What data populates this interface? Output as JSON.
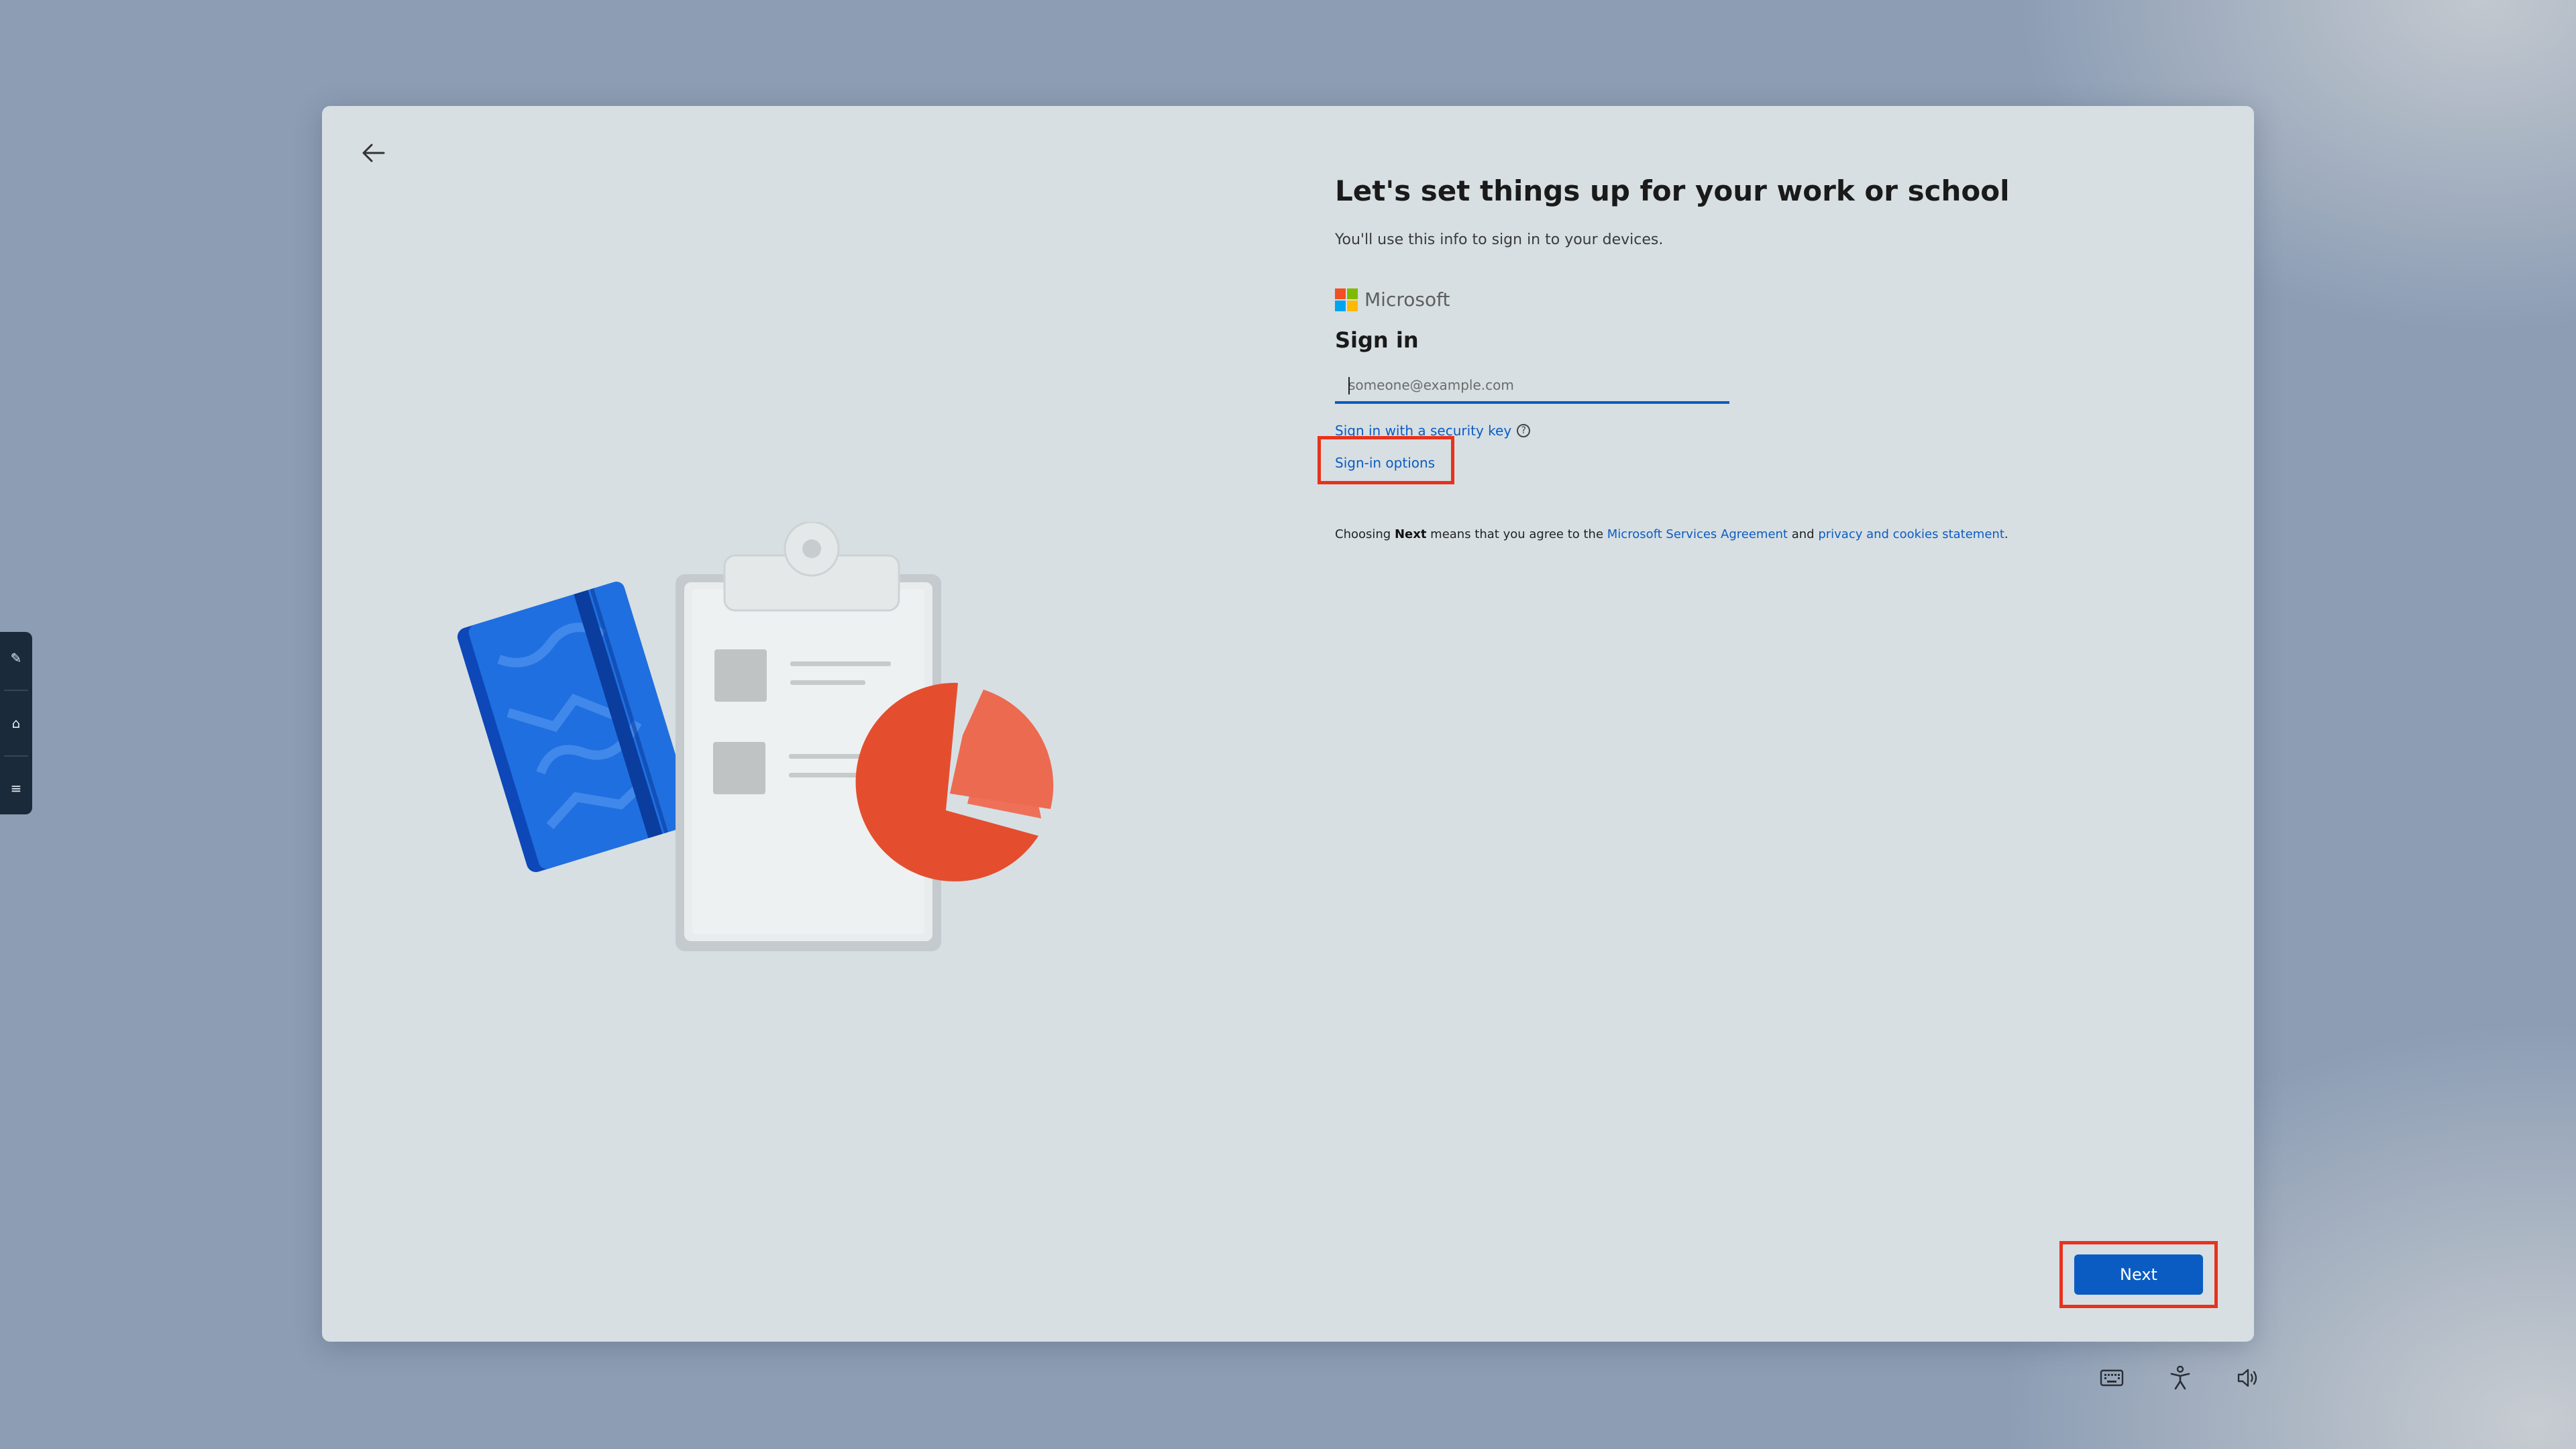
{
  "header": {
    "title": "Let's set things up for your work or school",
    "subtitle": "You'll use this info to sign in to your devices."
  },
  "brand": {
    "name": "Microsoft",
    "colors": [
      "#f25022",
      "#7fba00",
      "#00a4ef",
      "#ffb900"
    ]
  },
  "signin": {
    "heading": "Sign in",
    "email_value": "",
    "email_placeholder": "someone@example.com",
    "security_key_link": "Sign in with a security key",
    "help_icon_glyph": "?",
    "options_link": "Sign-in options"
  },
  "terms": {
    "prefix": "Choosing ",
    "bold": "Next",
    "middle": " means that you agree to the ",
    "link1": "Microsoft Services Agreement",
    "and": " and ",
    "link2": "privacy and cookies statement",
    "suffix": "."
  },
  "footer": {
    "next_label": "Next"
  },
  "side_panel": {
    "icons": [
      "pencil-icon",
      "home-icon",
      "menu-icon"
    ],
    "glyphs": [
      "✎",
      "⌂",
      "≡"
    ]
  },
  "tray": {
    "icons": [
      "keyboard-icon",
      "accessibility-icon",
      "volume-icon"
    ]
  },
  "colors": {
    "accent": "#0b5cc2",
    "highlight": "#e8321c",
    "card": "#d7dfe3",
    "desktop": "#8c9db4"
  }
}
